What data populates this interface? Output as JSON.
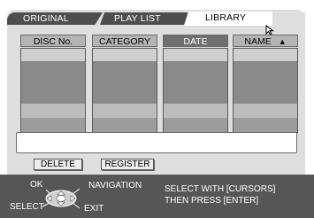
{
  "tabs": [
    {
      "label": "ORIGINAL",
      "active": false
    },
    {
      "label": "PLAY LIST",
      "active": false
    },
    {
      "label": "LIBRARY",
      "active": true
    }
  ],
  "columns": [
    {
      "label": "DISC No.",
      "active": false
    },
    {
      "label": "CATEGORY",
      "active": false
    },
    {
      "label": "DATE",
      "active": true
    },
    {
      "label": "NAME",
      "active": false,
      "sort_indicator": "▲"
    }
  ],
  "message": "",
  "buttons": {
    "delete": "DELETE",
    "register": "REGISTER"
  },
  "help": {
    "ok": "OK",
    "navigation": "NAVIGATION",
    "select": "SELECT",
    "exit": "EXIT",
    "instruction_line1": "SELECT WITH [CURSORS]",
    "instruction_line2": "THEN PRESS [ENTER]"
  },
  "colors": {
    "tab_bg": "#4e4e4e",
    "panel_bg": "#dedede",
    "help_bar_bg": "#565656",
    "active_header_bg": "#6f6f6f"
  }
}
